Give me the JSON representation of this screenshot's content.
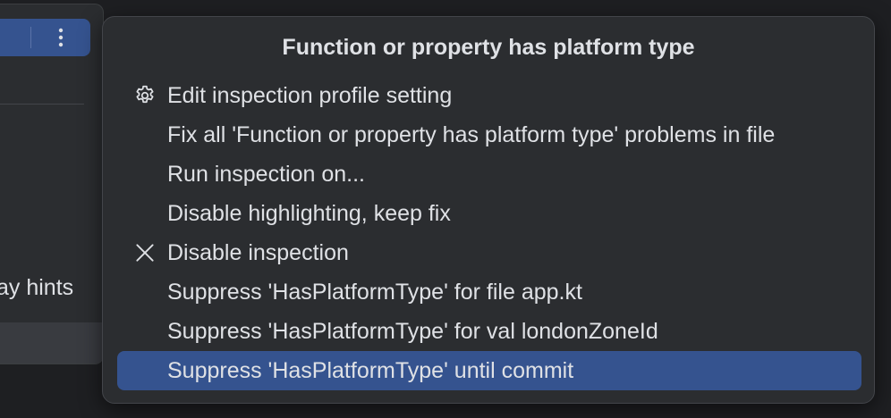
{
  "background_panel": {
    "hint_text": "ay hints",
    "more_icon": "vertical-ellipsis-icon"
  },
  "popup": {
    "title": "Function or property has platform type",
    "items": [
      {
        "label": "Edit inspection profile setting",
        "icon": "gear-icon"
      },
      {
        "label": "Fix all 'Function or property has platform type' problems in file",
        "icon": null
      },
      {
        "label": "Run inspection on...",
        "icon": null
      },
      {
        "label": "Disable highlighting, keep fix",
        "icon": null
      },
      {
        "label": "Disable inspection",
        "icon": "close-icon"
      },
      {
        "label": "Suppress 'HasPlatformType' for file app.kt",
        "icon": null
      },
      {
        "label": "Suppress 'HasPlatformType' for val londonZoneId",
        "icon": null
      },
      {
        "label": "Suppress 'HasPlatformType' until commit",
        "icon": null,
        "selected": true
      }
    ]
  },
  "colors": {
    "selection": "#35538f",
    "popup_bg": "#2b2d30",
    "window_bg": "#1e1f22",
    "text": "#dfe1e5"
  }
}
